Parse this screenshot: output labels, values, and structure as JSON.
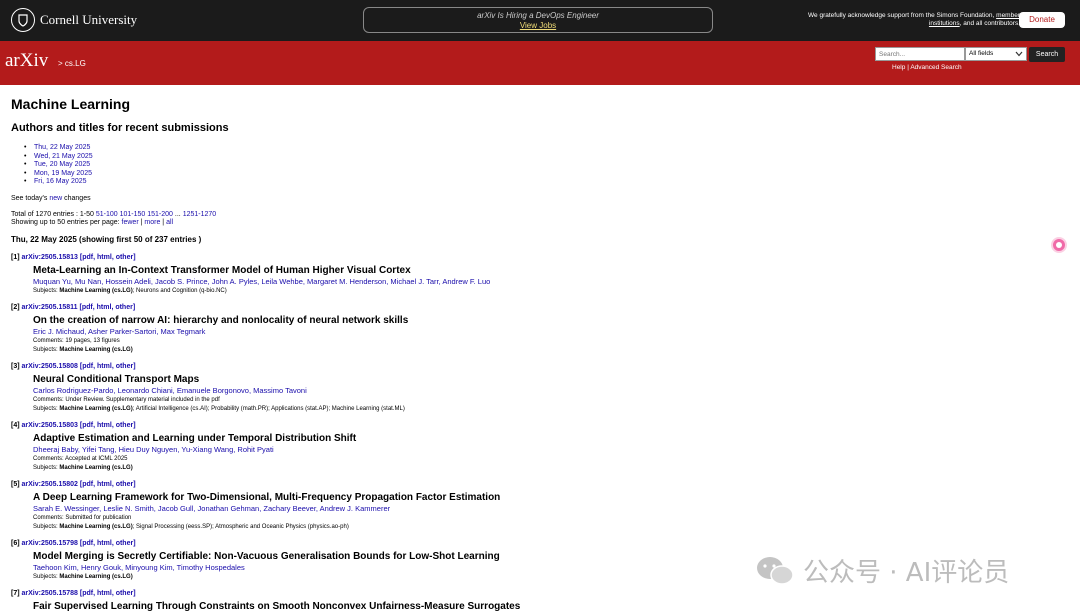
{
  "header": {
    "cornell_name": "Cornell University",
    "hiring_text": "arXiv Is Hiring a DevOps Engineer",
    "hiring_link": "View Jobs",
    "ack_part1": "We gratefully acknowledge support from the Simons Foundation,",
    "ack_link": "member institutions",
    "ack_part2": ", and all contributors.",
    "donate_label": "Donate"
  },
  "subheader": {
    "logo_text": "arXiv",
    "breadcrumb": "> cs.LG",
    "search_placeholder": "Search...",
    "field_selected": "All fields",
    "search_button": "Search",
    "help_label": "Help",
    "separator": "|",
    "advanced_label": "Advanced Search"
  },
  "page": {
    "title": "Machine Learning",
    "subtitle": "Authors and titles for recent submissions",
    "dates": [
      "Thu, 22 May 2025",
      "Wed, 21 May 2025",
      "Tue, 20 May 2025",
      "Mon, 19 May 2025",
      "Fri, 16 May 2025"
    ],
    "todays_prefix": "See today's",
    "todays_link": "new",
    "todays_suffix": "changes",
    "total_prefix": "Total of 1270 entries : 1-50",
    "pages": [
      "51-100",
      "101-150",
      "151-200"
    ],
    "ellipsis": "...",
    "last_page": "1251-1270",
    "showing_prefix": "Showing up to 50 entries per page:",
    "fewer": "fewer",
    "more": "more",
    "all": "all",
    "pipe": "|",
    "day_heading": "Thu, 22 May 2025 (showing first 50 of 237 entries )"
  },
  "entries": [
    {
      "index": "[1]",
      "id": "arXiv:2505.15813",
      "title": "Meta-Learning an In-Context Transformer Model of Human Higher Visual Cortex",
      "authors": "Muquan Yu, Mu Nan, Hossein Adeli, Jacob S. Prince, John A. Pyles, Leila Wehbe, Margaret M. Henderson, Michael J. Tarr, Andrew F. Luo",
      "comments": "",
      "subjects_primary": "Machine Learning (cs.LG)",
      "subjects_rest": "; Neurons and Cognition (q-bio.NC)"
    },
    {
      "index": "[2]",
      "id": "arXiv:2505.15811",
      "title": "On the creation of narrow AI: hierarchy and nonlocality of neural network skills",
      "authors": "Eric J. Michaud, Asher Parker-Sartori, Max Tegmark",
      "comments": "Comments: 19 pages, 13 figures",
      "subjects_primary": "Machine Learning (cs.LG)",
      "subjects_rest": ""
    },
    {
      "index": "[3]",
      "id": "arXiv:2505.15808",
      "title": "Neural Conditional Transport Maps",
      "authors": "Carlos Rodriguez-Pardo, Leonardo Chiani, Emanuele Borgonovo, Massimo Tavoni",
      "comments": "Comments: Under Review. Supplementary material included in the pdf",
      "subjects_primary": "Machine Learning (cs.LG)",
      "subjects_rest": "; Artificial Intelligence (cs.AI); Probability (math.PR); Applications (stat.AP); Machine Learning (stat.ML)"
    },
    {
      "index": "[4]",
      "id": "arXiv:2505.15803",
      "title": "Adaptive Estimation and Learning under Temporal Distribution Shift",
      "authors": "Dheeraj Baby, Yifei Tang, Hieu Duy Nguyen, Yu-Xiang Wang, Rohit Pyati",
      "comments": "Comments: Accepted at ICML 2025",
      "subjects_primary": "Machine Learning (cs.LG)",
      "subjects_rest": ""
    },
    {
      "index": "[5]",
      "id": "arXiv:2505.15802",
      "title": "A Deep Learning Framework for Two-Dimensional, Multi-Frequency Propagation Factor Estimation",
      "authors": "Sarah E. Wessinger, Leslie N. Smith, Jacob Gull, Jonathan Gehman, Zachary Beever, Andrew J. Kammerer",
      "comments": "Comments: Submitted for publication",
      "subjects_primary": "Machine Learning (cs.LG)",
      "subjects_rest": "; Signal Processing (eess.SP); Atmospheric and Oceanic Physics (physics.ao-ph)"
    },
    {
      "index": "[6]",
      "id": "arXiv:2505.15798",
      "title": "Model Merging is Secretly Certifiable: Non-Vacuous Generalisation Bounds for Low-Shot Learning",
      "authors": "Taehoon Kim, Henry Gouk, Minyoung Kim, Timothy Hospedales",
      "comments": "",
      "subjects_primary": "Machine Learning (cs.LG)",
      "subjects_rest": ""
    },
    {
      "index": "[7]",
      "id": "arXiv:2505.15788",
      "title": "Fair Supervised Learning Through Constraints on Smooth Nonconvex Unfairness-Measure Surrogates",
      "authors": "",
      "comments": "",
      "subjects_primary": "",
      "subjects_rest": ""
    }
  ],
  "entry_labels": {
    "pdf": "pdf",
    "html": "html",
    "other": "other",
    "subjects_prefix": "Subjects:"
  },
  "watermark": {
    "text": "公众号 · AI评论员"
  },
  "colors": {
    "topbar": "#1b1b1b",
    "arxiv_red": "#b31b1b",
    "link": "#1a0dab"
  }
}
